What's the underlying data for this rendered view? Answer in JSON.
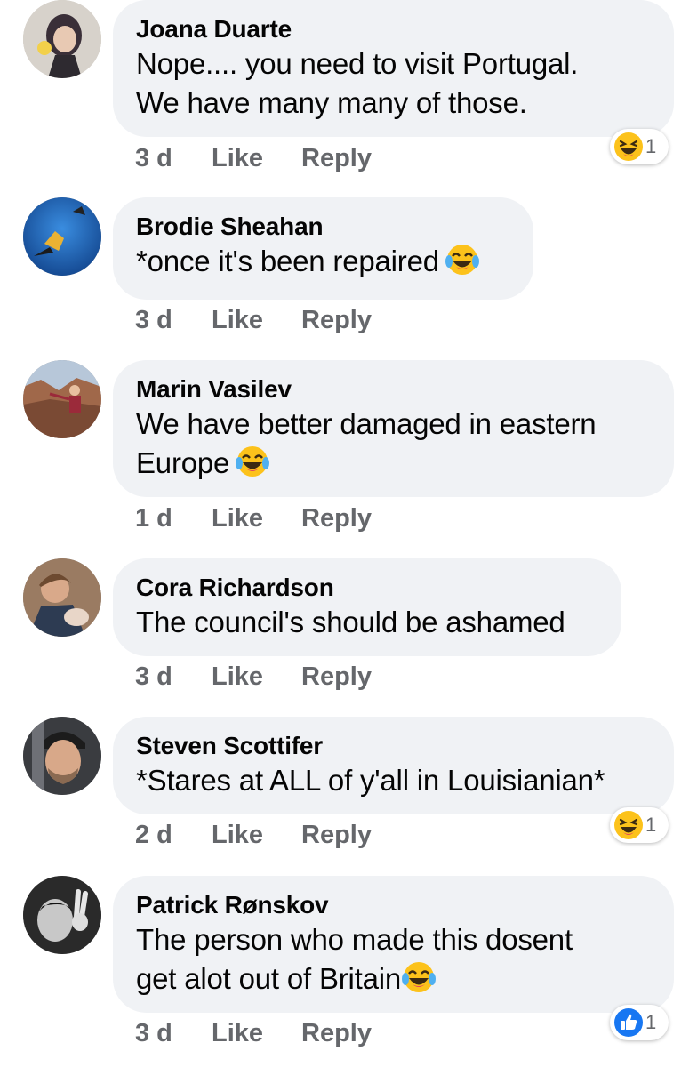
{
  "comments": [
    {
      "author": "Joana Duarte",
      "lines": [
        "Nope.... you need to visit Portugal.",
        "We have many many of those."
      ],
      "time": "3 d",
      "like_label": "Like",
      "reply_label": "Reply",
      "reaction": {
        "icon": "laughing-squint-emoji",
        "count": "1"
      }
    },
    {
      "author": "Brodie Sheahan",
      "lines": [
        "*once it's been repaired"
      ],
      "inline_emoji": "tears-of-joy-emoji",
      "time": "3 d",
      "like_label": "Like",
      "reply_label": "Reply"
    },
    {
      "author": "Marin Vasilev",
      "lines": [
        "We have better damaged in eastern",
        "Europe"
      ],
      "inline_emoji": "tears-of-joy-emoji",
      "time": "1 d",
      "like_label": "Like",
      "reply_label": "Reply"
    },
    {
      "author": "Cora Richardson",
      "lines": [
        "The council's should be ashamed"
      ],
      "time": "3 d",
      "like_label": "Like",
      "reply_label": "Reply"
    },
    {
      "author": "Steven Scottifer",
      "lines": [
        "*Stares at ALL of y'all in Louisianian*"
      ],
      "time": "2 d",
      "like_label": "Like",
      "reply_label": "Reply",
      "reaction": {
        "icon": "laughing-squint-emoji",
        "count": "1"
      }
    },
    {
      "author": "Patrick Rønskov",
      "lines": [
        "The person who made this dosent",
        "get alot out of Britain"
      ],
      "inline_emoji": "tears-of-joy-emoji",
      "time": "3 d",
      "like_label": "Like",
      "reply_label": "Reply",
      "reaction": {
        "icon": "thumbs-up-like-icon",
        "count": "1"
      }
    }
  ],
  "colors": {
    "bubble": "#f0f2f5",
    "meta_text": "#65676b",
    "like_blue": "#1877f2",
    "emoji_yellow": "#fcc21b"
  }
}
